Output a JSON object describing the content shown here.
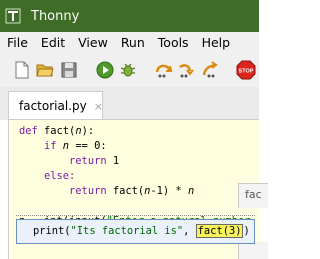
{
  "window": {
    "title": "Thonny"
  },
  "menu": [
    "File",
    "Edit",
    "View",
    "Run",
    "Tools",
    "Help"
  ],
  "toolbar": {
    "icons": [
      "new-file",
      "open-file",
      "save-file",
      "run",
      "debug",
      "step-over",
      "step-into",
      "step-out",
      "stop"
    ],
    "stop_label": "STOP"
  },
  "editor": {
    "tab_label": "factorial.py",
    "tab_close": "×",
    "lines": [
      [
        "def",
        " fact(",
        "n",
        "):"
      ],
      [
        "    if ",
        "n",
        " == 0:"
      ],
      [
        "        return",
        " 1"
      ],
      [
        "    else:"
      ],
      [
        "        return",
        " fact(",
        "n",
        "-1) * ",
        "n"
      ],
      [
        ""
      ],
      [
        "n",
        " = int(input(",
        "\"Enter a natural number",
        ""
      ]
    ]
  },
  "side_panel": {
    "label": "fac"
  },
  "popup": {
    "prefix": "print(",
    "string": "\"Its factorial is\"",
    "sep": ", ",
    "call": "fact(3)",
    "suffix": ")"
  },
  "colors": {
    "title_bg": "#3f6c26",
    "editor_bg": "#ffffe0",
    "keyword": "#7a1ea1",
    "string": "#006400",
    "highlight": "#f7f25a"
  }
}
